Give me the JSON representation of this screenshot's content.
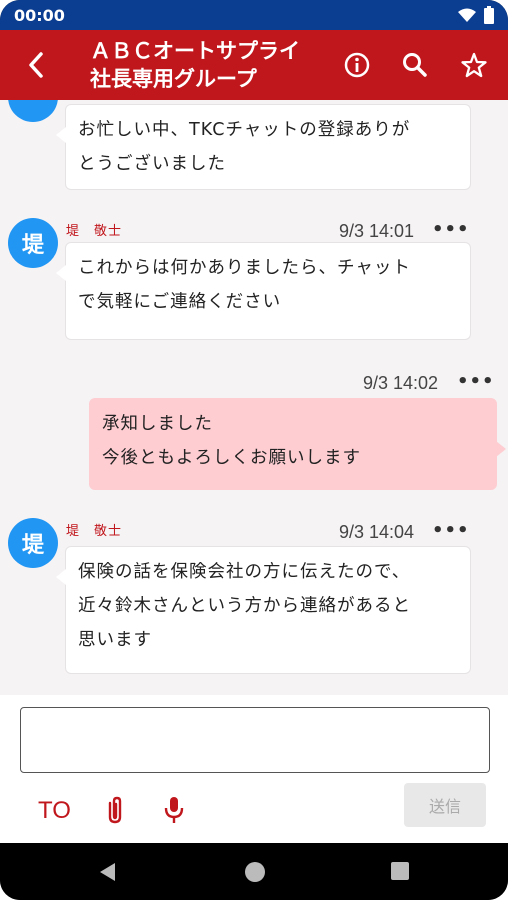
{
  "status": {
    "time": "00:00",
    "icons": [
      "wifi-icon",
      "battery-icon"
    ]
  },
  "header": {
    "title_line1": "ＡＢＣオートサプライ",
    "title_line2": "社長専用グループ",
    "actions": [
      "info-icon",
      "search-icon",
      "star-icon"
    ],
    "color": "#c0171d"
  },
  "messages": [
    {
      "avatar": "",
      "sender": "",
      "time": "",
      "lines": [
        "お忙しい中、TKCチャットの登録ありが",
        "とうございました"
      ]
    },
    {
      "avatar": "堤",
      "sender": "堤　敬士",
      "time": "9/3 14:01",
      "menu": "•••",
      "lines": [
        "これからは何かありましたら、チャット",
        "で気軽にご連絡ください"
      ]
    },
    {
      "mine": true,
      "time": "9/3 14:02",
      "menu": "•••",
      "lines": [
        "承知しました",
        "今後ともよろしくお願いします"
      ]
    },
    {
      "avatar": "堤",
      "sender": "堤　敬士",
      "time": "9/3 14:04",
      "menu": "•••",
      "lines": [
        "保険の話を保険会社の方に伝えたので、",
        "近々鈴木さんという方から連絡があると",
        "思います"
      ]
    }
  ],
  "composer": {
    "input_value": "",
    "to_label": "TO",
    "send_label": "送信",
    "icons": [
      "paperclip-icon",
      "microphone-icon"
    ]
  },
  "colors": {
    "accent": "#c0171d",
    "status_bar": "#0b3d91",
    "avatar": "#2196f3",
    "own_bubble": "#fdcdd2"
  }
}
